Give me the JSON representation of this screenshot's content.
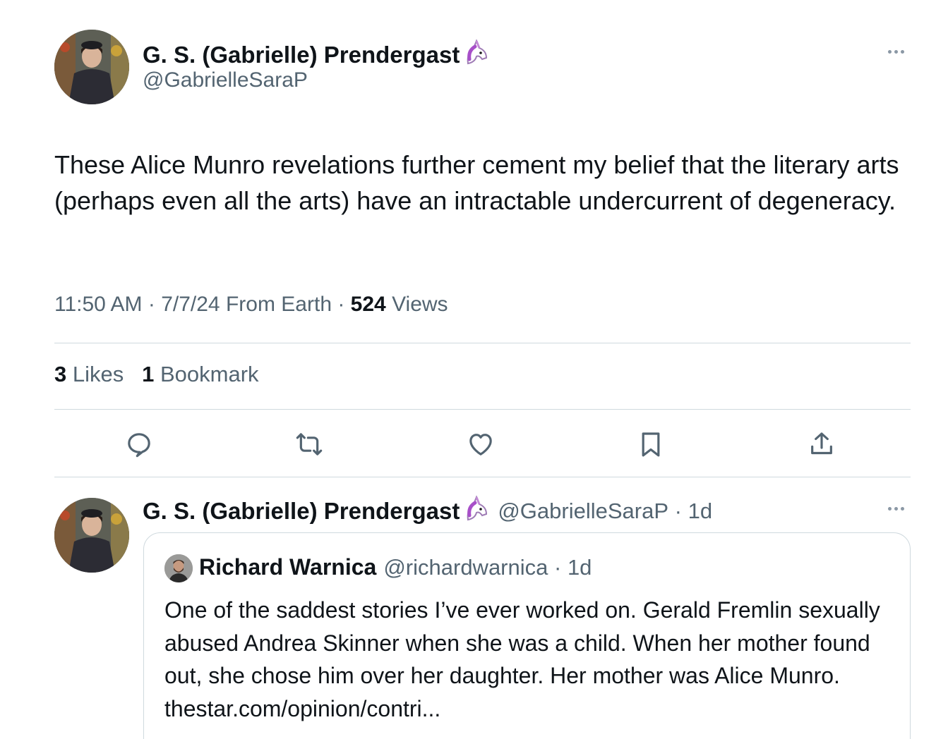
{
  "main_tweet": {
    "author": {
      "display_name": "G. S. (Gabrielle) Prendergast",
      "handle": "@GabrielleSaraP",
      "badge_icon": "unicorn-icon",
      "avatar_icon": "profile-photo"
    },
    "text": "These Alice Munro revelations further cement my belief that the literary arts (perhaps even all the arts) have an intractable undercurrent of degeneracy.",
    "time": "11:50 AM",
    "date": "7/7/24",
    "source": "From Earth",
    "views_count": "524",
    "views_label": "Views",
    "likes_count": "3",
    "likes_label": "Likes",
    "bookmarks_count": "1",
    "bookmarks_label": "Bookmark",
    "actions": [
      "reply-icon",
      "retweet-icon",
      "like-icon",
      "bookmark-icon",
      "share-icon"
    ]
  },
  "reply_tweet": {
    "author": {
      "display_name": "G. S. (Gabrielle) Prendergast",
      "handle": "@GabrielleSaraP",
      "time_ago": "1d",
      "badge_icon": "unicorn-icon"
    },
    "quoted": {
      "display_name": "Richard Warnica",
      "handle": "@richardwarnica",
      "time_ago": "1d",
      "text": "One of the saddest stories I’ve ever worked on. Gerald Fremlin sexually abused Andrea Skinner when she was a child. When her mother found out, she chose him over her daughter. Her mother was Alice Munro. thestar.com/opinion/contri..."
    }
  },
  "colors": {
    "text_primary": "#0f1419",
    "text_secondary": "#536471",
    "divider": "#cfd9de",
    "icon": "#536471"
  }
}
